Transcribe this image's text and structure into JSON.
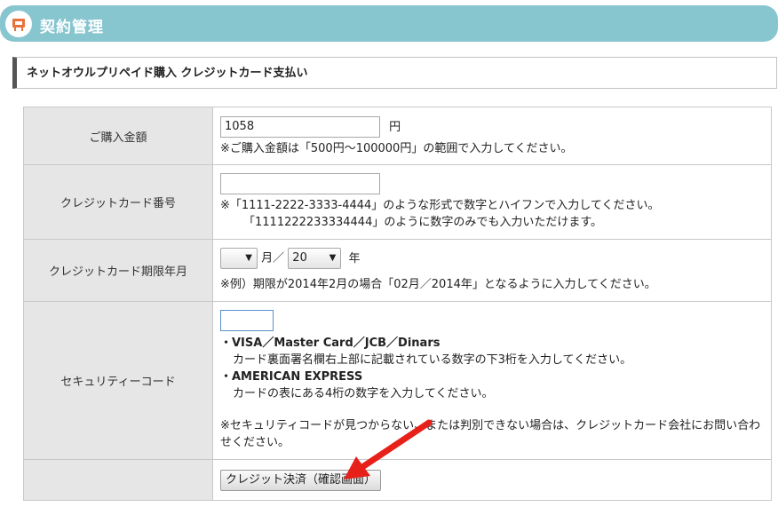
{
  "header": {
    "title": "契約管理",
    "icon": "contract-icon"
  },
  "subhead": {
    "title": "ネットオウルプリペイド購入 クレジットカード支払い"
  },
  "form": {
    "amount": {
      "label": "ご購入金額",
      "value": "1058",
      "unit": "円",
      "note": "※ご購入金額は「500円～100000円」の範囲で入力してください。"
    },
    "card_number": {
      "label": "クレジットカード番号",
      "value": "",
      "note1": "※「1111-2222-3333-4444」のような形式で数字とハイフンで入力してください。",
      "note2": "「1111222233334444」のように数字のみでも入力いただけます。"
    },
    "expiry": {
      "label": "クレジットカード期限年月",
      "month_value": "",
      "month_suffix": "月／",
      "year_value": "20",
      "year_suffix": "年",
      "note": "※例）期限が2014年2月の場合「02月／2014年」となるように入力してください。"
    },
    "security": {
      "label": "セキュリティーコード",
      "value": "",
      "brand1": "・VISA／Master Card／JCB／Dinars",
      "brand1_desc": "カード裏面署名欄右上部に記載されている数字の下3桁を入力してください。",
      "brand2": "・AMERICAN EXPRESS",
      "brand2_desc": "カードの表にある4桁の数字を入力してください。",
      "note": "※セキュリティコードが見つからない、または判別できない場合は、クレジットカード会社にお問い合わせください。"
    },
    "submit_label": "クレジット決済（確認画面）"
  },
  "colors": {
    "header_bg": "#87c5cf",
    "label_bg": "#e6e6e6",
    "arrow": "#e8201a"
  }
}
